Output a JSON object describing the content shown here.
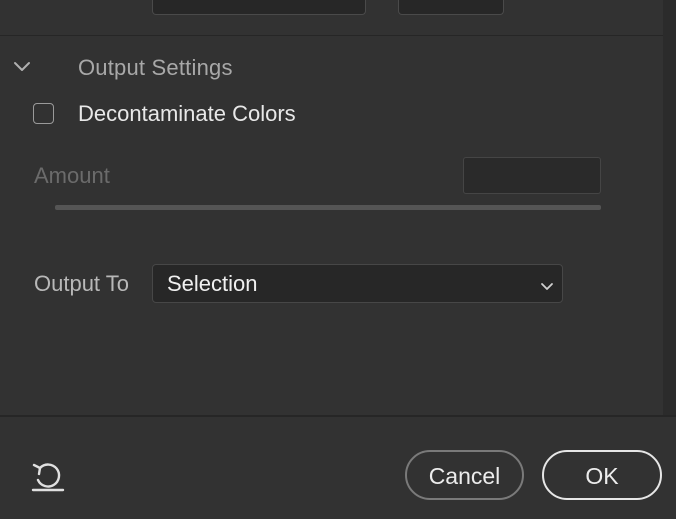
{
  "section": {
    "title": "Output Settings",
    "expanded": true
  },
  "decontaminate": {
    "label": "Decontaminate Colors",
    "checked": false
  },
  "amount": {
    "label": "Amount",
    "value": "",
    "enabled": false
  },
  "output_to": {
    "label": "Output To",
    "selected": "Selection"
  },
  "footer": {
    "reset_icon": "reset-icon",
    "cancel_label": "Cancel",
    "ok_label": "OK"
  },
  "colors": {
    "background": "#323232",
    "field_background": "#272727",
    "text_primary": "#e8e8e8",
    "text_muted": "#a8a8a8",
    "text_disabled": "#6b6b6b"
  }
}
